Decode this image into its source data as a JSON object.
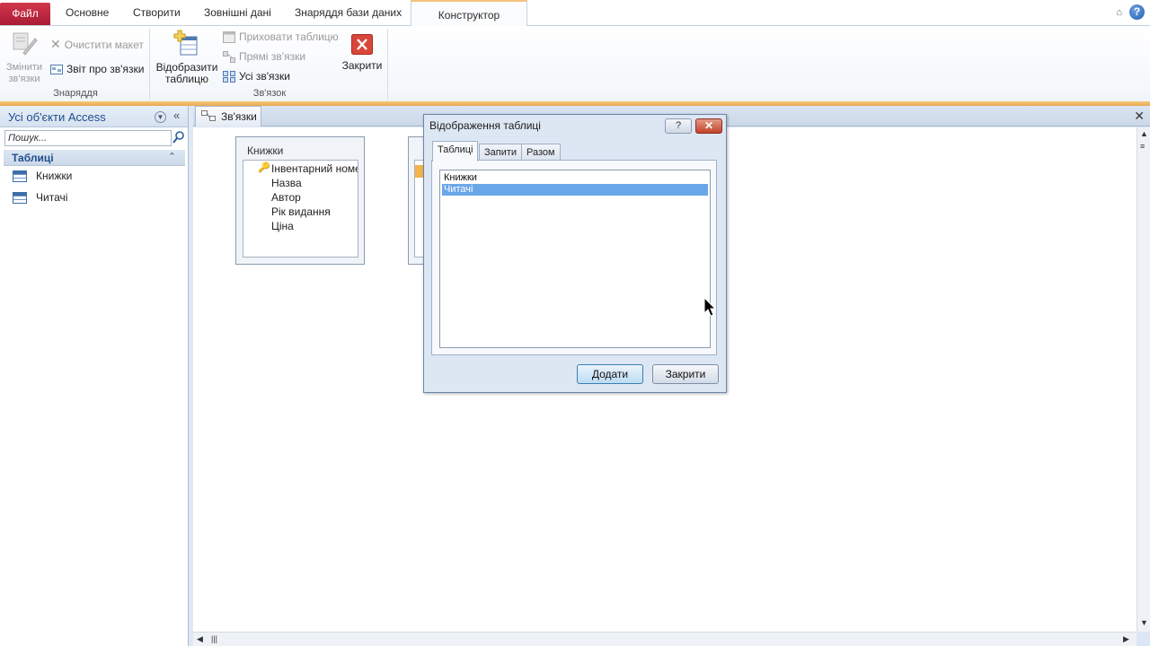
{
  "ribbon_tabs": {
    "file": "Файл",
    "home": "Основне",
    "create": "Створити",
    "external": "Зовнішні дані",
    "dbtools": "Знаряддя бази даних",
    "design": "Конструктор"
  },
  "ribbon": {
    "edit_relationships": "Змінити\nзв'язки",
    "clear_layout": "Очистити макет",
    "relationship_report": "Звіт про зв'язки",
    "tools_group": "Знаряддя",
    "show_table": "Відобразити\nтаблицю",
    "hide_table": "Приховати таблицю",
    "direct_relationships": "Прямі зв'язки",
    "all_relationships": "Усі зв'язки",
    "relationships_group": "Зв'язок",
    "close": "Закрити"
  },
  "nav": {
    "title": "Усі об'єкти Access",
    "search_placeholder": "Пошук...",
    "section": "Таблиці",
    "items": [
      "Книжки",
      "Читачі"
    ]
  },
  "document": {
    "tab_label": "Зв'язки"
  },
  "field_list": {
    "title": "Книжки",
    "fields": [
      "Інвентарний номе",
      "Назва",
      "Автор",
      "Рік видання",
      "Ціна"
    ]
  },
  "dialog": {
    "title": "Відображення таблиці",
    "help": "?",
    "tabs": [
      "Таблиці",
      "Запити",
      "Разом"
    ],
    "list": [
      "Книжки",
      "Читачі"
    ],
    "selected_index": 1,
    "add_button": "Додати",
    "close_button": "Закрити"
  },
  "colors": {
    "file_tab": "#c0283f",
    "selection": "#6aa7e8",
    "accent": "#1f4e8c"
  }
}
